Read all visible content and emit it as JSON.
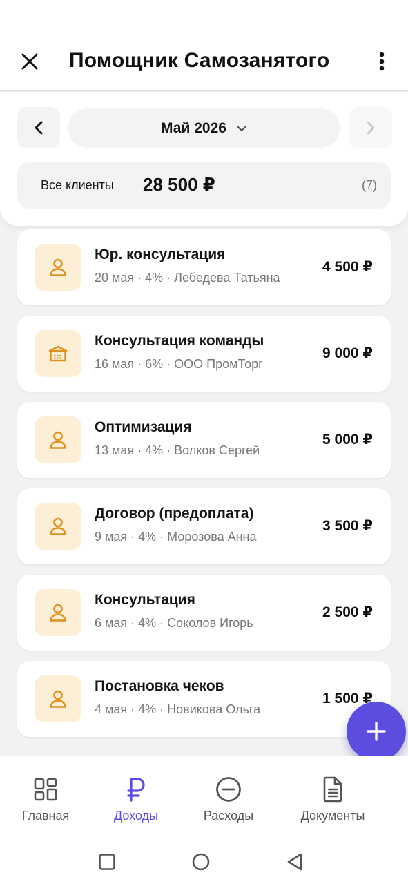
{
  "header": {
    "title": "Помощник Самозанятого",
    "close_icon": "close-icon",
    "menu_icon": "more-vertical-icon"
  },
  "period": {
    "month_label": "Май 2026",
    "prev_icon": "chevron-left-icon",
    "next_icon": "chevron-right-icon",
    "dropdown_icon": "chevron-down-icon",
    "next_disabled": true
  },
  "summary": {
    "clients_label": "Все клиенты",
    "total": "28 500 ₽",
    "count": "(7)"
  },
  "incomes": [
    {
      "title": "Юр. консультация",
      "meta": "20 мая · 4% · Лебедева Татьяна",
      "amount": "4 500 ₽",
      "icon": "person-icon"
    },
    {
      "title": "Консультация команды",
      "meta": "16 мая · 6% · ООО ПромТорг",
      "amount": "9 000 ₽",
      "icon": "company-icon"
    },
    {
      "title": "Оптимизация",
      "meta": "13 мая · 4% · Волков Сергей",
      "amount": "5 000 ₽",
      "icon": "person-icon"
    },
    {
      "title": "Договор (предоплата)",
      "meta": "9 мая · 4% · Морозова Анна",
      "amount": "3 500 ₽",
      "icon": "person-icon"
    },
    {
      "title": "Консультация",
      "meta": "6 мая · 4% · Соколов Игорь",
      "amount": "2 500 ₽",
      "icon": "person-icon"
    },
    {
      "title": "Постановка чеков",
      "meta": "4 мая · 4% · Новикова Ольга",
      "amount": "1 500 ₽",
      "icon": "person-icon"
    }
  ],
  "fab": {
    "icon": "plus-icon"
  },
  "bottom_nav": {
    "tabs": [
      {
        "label": "Главная",
        "icon": "dashboard-icon",
        "active": false
      },
      {
        "label": "Доходы",
        "icon": "ruble-icon",
        "active": true
      },
      {
        "label": "Расходы",
        "icon": "minus-circle-icon",
        "active": false
      },
      {
        "label": "Документы",
        "icon": "document-icon",
        "active": false
      }
    ]
  },
  "colors": {
    "accent": "#5b4de0",
    "icon_tile_bg": "#fdefd6",
    "icon_tile_fg": "#e0901c",
    "background": "#f2f2f2",
    "muted_text": "#777777"
  }
}
